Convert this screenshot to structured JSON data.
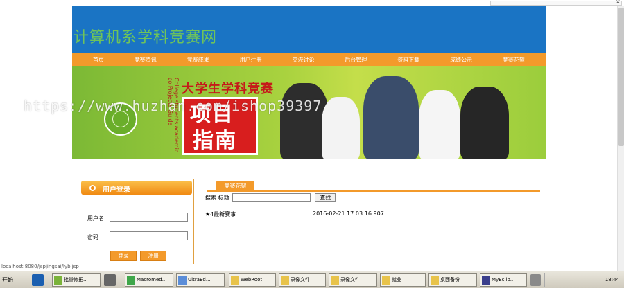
{
  "browser": {
    "close_glyph": "×"
  },
  "site": {
    "title": "计算机系学科竞赛网"
  },
  "nav": [
    "首页",
    "竞赛资讯",
    "竞赛成果",
    "用户注册",
    "交流讨论",
    "后台管理",
    "资料下载",
    "成绩公示",
    "竞赛花絮"
  ],
  "banner": {
    "headline": "大学生学科竞赛",
    "big_line1": "项目",
    "big_line2": "指南",
    "vertical_text": "College students academic co Projects Guide"
  },
  "watermark": "https://www.huzhan.com/ishop39397",
  "login": {
    "title": "用户登录",
    "username_label": "用户名",
    "password_label": "密码",
    "login_button": "登录",
    "register_button": "注册"
  },
  "content": {
    "tab": "竞赛花絮",
    "search_label": "搜索:标题:",
    "search_value": "",
    "search_button": "查找",
    "items": [
      {
        "title": "★4最新赛事",
        "date": "2016-02-21 17:03:16.907"
      }
    ]
  },
  "statusbar": {
    "url": "localhost:8080/jspjingsai/lyb.jsp"
  },
  "taskbar": {
    "start": "开始",
    "buttons": [
      "批量修拓...",
      "Macromed...",
      "UltraEd...",
      "WebRoot",
      "录像文件",
      "录像文件",
      "就业",
      "桌面备份",
      "MyEclip..."
    ],
    "clock": "18:44"
  },
  "colors": {
    "header_blue": "#1a74c4",
    "accent_orange": "#f39a2b",
    "title_green": "#6fc45a"
  }
}
